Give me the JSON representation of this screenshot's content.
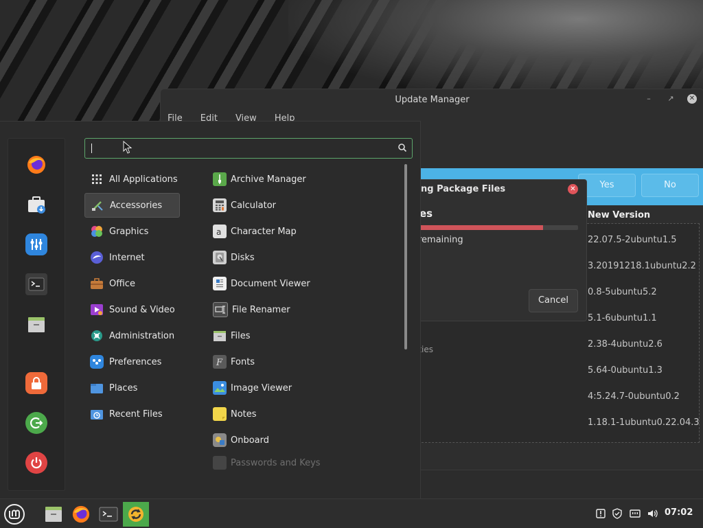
{
  "update_manager": {
    "title": "Update Manager",
    "menu": [
      "File",
      "Edit",
      "View",
      "Help"
    ],
    "infobar_buttons": {
      "yes": "Yes",
      "no": "No"
    },
    "column_new_version": "New Version",
    "versions": [
      "22.07.5-2ubuntu1.5",
      "3.20191218.1ubuntu2.2",
      "0.8-5ubuntu5.2",
      "5.1-6ubuntu1.1",
      "2.38-4ubuntu2.6",
      "5.64-0ubuntu1.3",
      "4:5.24.7-0ubuntu0.2",
      "1.18.1-1ubuntu0.22.04.3"
    ],
    "partial_text": "ities"
  },
  "dialog": {
    "title": "ng Package Files",
    "heading": "es",
    "progress_fraction": 0.78,
    "subtitle": "remaining",
    "cancel_label": "Cancel"
  },
  "menu": {
    "search": {
      "value": "",
      "placeholder": ""
    },
    "categories": [
      {
        "label": "All Applications",
        "icon": "grid-icon"
      },
      {
        "label": "Accessories",
        "icon": "accessories-icon",
        "selected": true
      },
      {
        "label": "Graphics",
        "icon": "graphics-icon"
      },
      {
        "label": "Internet",
        "icon": "internet-icon"
      },
      {
        "label": "Office",
        "icon": "office-icon"
      },
      {
        "label": "Sound & Video",
        "icon": "sound-video-icon"
      },
      {
        "label": "Administration",
        "icon": "administration-icon"
      },
      {
        "label": "Preferences",
        "icon": "preferences-icon"
      },
      {
        "label": "Places",
        "icon": "places-icon"
      },
      {
        "label": "Recent Files",
        "icon": "recent-files-icon"
      }
    ],
    "apps": [
      {
        "label": "Archive Manager",
        "icon": "archive-manager-icon"
      },
      {
        "label": "Calculator",
        "icon": "calculator-icon"
      },
      {
        "label": "Character Map",
        "icon": "character-map-icon"
      },
      {
        "label": "Disks",
        "icon": "disks-icon"
      },
      {
        "label": "Document Viewer",
        "icon": "document-viewer-icon"
      },
      {
        "label": "File Renamer",
        "icon": "file-renamer-icon"
      },
      {
        "label": "Files",
        "icon": "files-icon"
      },
      {
        "label": "Fonts",
        "icon": "fonts-icon"
      },
      {
        "label": "Image Viewer",
        "icon": "image-viewer-icon"
      },
      {
        "label": "Notes",
        "icon": "notes-icon"
      },
      {
        "label": "Onboard",
        "icon": "onboard-icon"
      },
      {
        "label": "Passwords and Keys",
        "icon": "passwords-keys-icon"
      }
    ],
    "favorites": [
      "firefox-icon",
      "software-manager-icon",
      "system-settings-icon",
      "terminal-icon",
      "files-icon",
      "lock-screen-icon",
      "logout-icon",
      "power-icon"
    ]
  },
  "taskbar": {
    "launchers": [
      "mint-menu-icon",
      "files-icon",
      "firefox-icon",
      "terminal-icon",
      "update-manager-icon"
    ],
    "tray": [
      "notification-icon",
      "shield-icon",
      "network-icon",
      "volume-icon"
    ],
    "clock": "07:02"
  },
  "colors": {
    "accent_green": "#5da66b",
    "info_blue": "#4cb3e6",
    "dialog_close_red": "#e0545a",
    "progress_red": "#d0545a"
  }
}
